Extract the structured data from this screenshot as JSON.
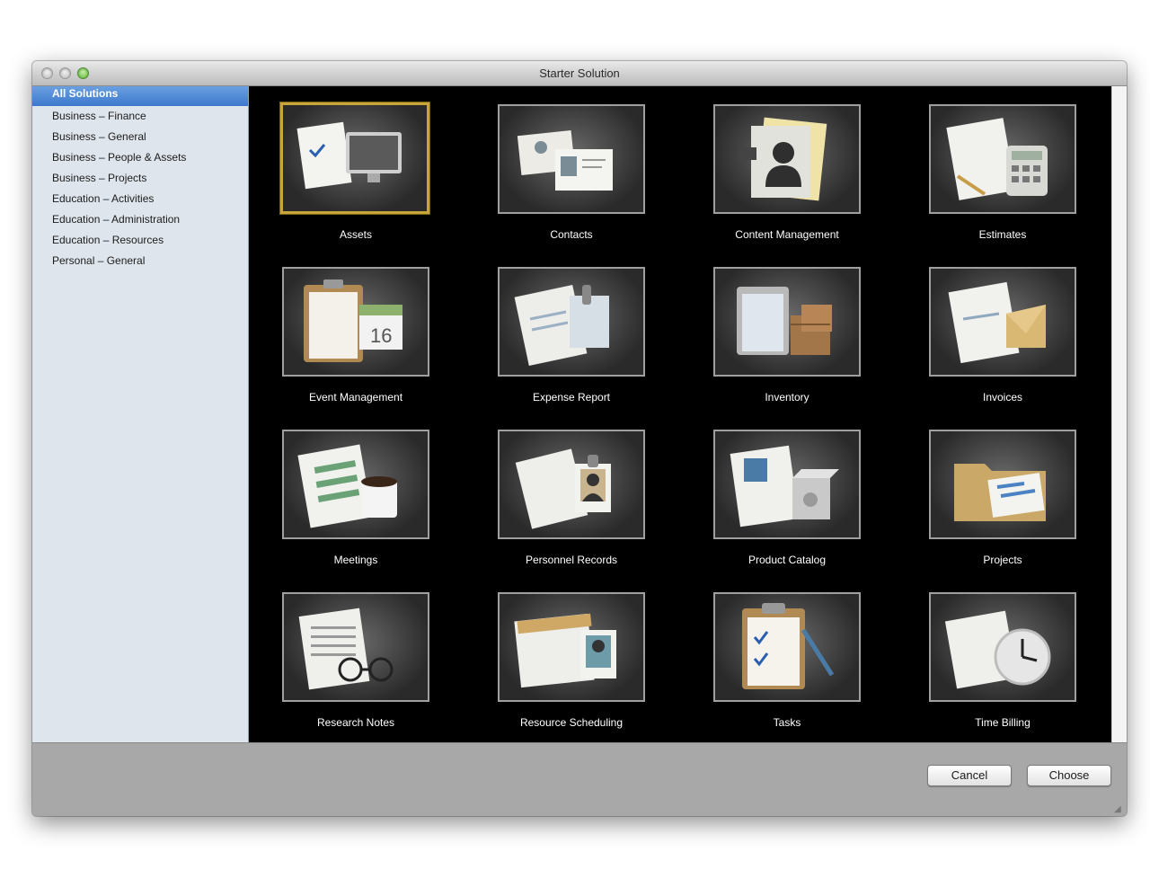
{
  "window": {
    "title": "Starter Solution"
  },
  "sidebar": {
    "items": [
      {
        "label": "All Solutions",
        "selected": true
      },
      {
        "label": "Business – Finance"
      },
      {
        "label": "Business – General"
      },
      {
        "label": "Business – People & Assets"
      },
      {
        "label": "Business – Projects"
      },
      {
        "label": "Education – Activities"
      },
      {
        "label": "Education – Administration"
      },
      {
        "label": "Education – Resources"
      },
      {
        "label": "Personal – General"
      }
    ]
  },
  "solutions": [
    {
      "label": "Assets",
      "icon": "assets-icon",
      "selected": true
    },
    {
      "label": "Contacts",
      "icon": "contacts-icon"
    },
    {
      "label": "Content Management",
      "icon": "content-management-icon"
    },
    {
      "label": "Estimates",
      "icon": "estimates-icon"
    },
    {
      "label": "Event Management",
      "icon": "event-management-icon"
    },
    {
      "label": "Expense Report",
      "icon": "expense-report-icon"
    },
    {
      "label": "Inventory",
      "icon": "inventory-icon"
    },
    {
      "label": "Invoices",
      "icon": "invoices-icon"
    },
    {
      "label": "Meetings",
      "icon": "meetings-icon"
    },
    {
      "label": "Personnel Records",
      "icon": "personnel-records-icon"
    },
    {
      "label": "Product Catalog",
      "icon": "product-catalog-icon"
    },
    {
      "label": "Projects",
      "icon": "projects-icon"
    },
    {
      "label": "Research Notes",
      "icon": "research-notes-icon"
    },
    {
      "label": "Resource Scheduling",
      "icon": "resource-scheduling-icon"
    },
    {
      "label": "Tasks",
      "icon": "tasks-icon"
    },
    {
      "label": "Time Billing",
      "icon": "time-billing-icon"
    }
  ],
  "buttons": {
    "cancel": "Cancel",
    "choose": "Choose"
  },
  "colors": {
    "selection": "#3d78cc",
    "tile_selected_border": "#c8a53a",
    "content_bg": "#000000"
  }
}
